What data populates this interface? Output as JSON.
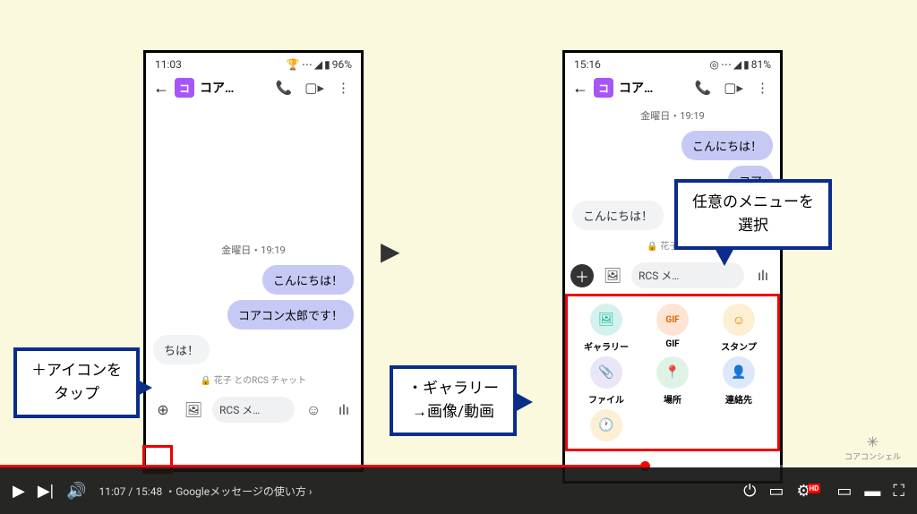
{
  "left": {
    "status": {
      "time": "11:03",
      "trophy": "🏆",
      "battery": "96%"
    },
    "contact_initial": "コ",
    "contact_name": "コア…",
    "timestamp": "金曜日・19:19",
    "msg_sent_1": "こんにちは！",
    "msg_sent_2": "コアコン太郎です！",
    "msg_recv_1": "ちは！",
    "rcs_note": "🔒 花子 とのRCS チャット",
    "compose": "RCS メ…"
  },
  "right": {
    "status": {
      "time": "15:16",
      "icon": "◎",
      "battery": "81%"
    },
    "contact_initial": "コ",
    "contact_name": "コア…",
    "timestamp": "金曜日・19:19",
    "msg_sent_1": "こんにちは！",
    "msg_sent_2": "コア",
    "msg_recv_1": "こんにちは！",
    "rcs_note": "🔒 花子 との",
    "compose": "RCS メ…",
    "grid": {
      "gallery": "ギャラリー",
      "gif": "GIF",
      "stamp": "スタンプ",
      "file": "ファイル",
      "location": "場所",
      "contact": "連絡先"
    }
  },
  "callouts": {
    "c1": "＋アイコンを\nタップ",
    "c2": "任意のメニューを\n選択",
    "c3": "・ギャラリー\n→画像/動画"
  },
  "logo": "コアコンシェル",
  "video": {
    "current": "11:07",
    "total": "15:48",
    "chapter": "・Googleメッセージの使い方",
    "hd": "HD"
  }
}
